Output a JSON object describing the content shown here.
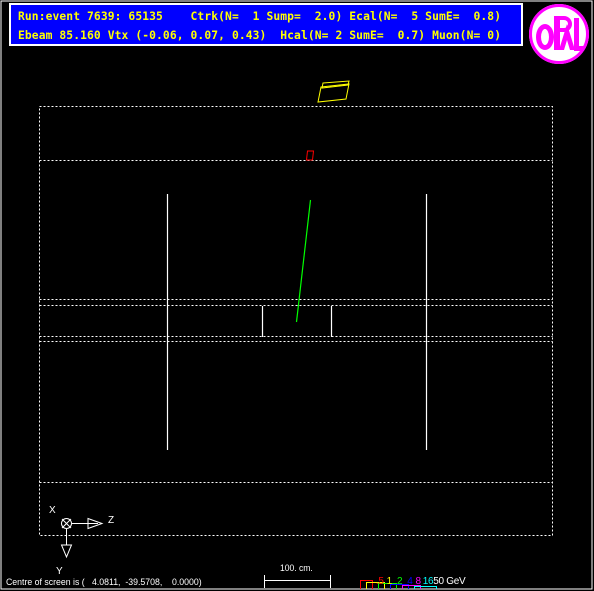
{
  "header": {
    "line1": "Run:event 7639: 65135    Ctrk(N=  1 Sump=  2.0) Ecal(N=  5 SumE=  0.8)",
    "line2": "Ebeam 85.160 Vtx (-0.06, 0.07, 0.43)  Hcal(N= 2 SumE=  0.7) Muon(N= 0)"
  },
  "logo": {
    "name": "OPAL",
    "colors": {
      "ring": "#ff00ff",
      "background": "#ffffff"
    }
  },
  "axes": {
    "x_label": "X",
    "z_label": "Z",
    "y_label": "Y"
  },
  "scale_bar": {
    "label": "100. cm."
  },
  "energy_legend": {
    "items": [
      {
        "text": ".5",
        "color": "#ff0000"
      },
      {
        "text": "1",
        "color": "#ffff00"
      },
      {
        "text": "2",
        "color": "#00ff00"
      },
      {
        "text": "4",
        "color": "#0000ff"
      },
      {
        "text": "8",
        "color": "#ff00ff"
      },
      {
        "text": "16",
        "color": "#00ffff"
      },
      {
        "text": "50 GeV",
        "color": "#ffffff"
      }
    ]
  },
  "status": {
    "text": "Centre of screen is (   4.0811,  -39.5708,    0.0000)"
  },
  "colors": {
    "background": "#000000",
    "panel": "#0000ff",
    "panel_text": "#ffff00",
    "detector_lines": "#ffffff",
    "track": "#00ff00",
    "ecal_hit": "#ff0000",
    "hcal_hit": "#ffff00"
  }
}
